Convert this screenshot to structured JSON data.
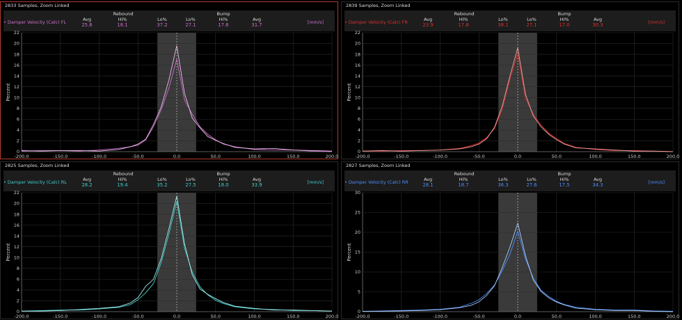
{
  "common": {
    "group_rebound": "Rebound",
    "group_bump": "Bump",
    "stat_labels": [
      "Avg",
      "Hi%",
      "Lo%",
      "Lo%",
      "Hi%",
      "Avg"
    ],
    "unit": "[mm/s]",
    "y_axis_label": "Percent"
  },
  "panels": [
    {
      "title": "2833 Samples, Zoom Linked",
      "legend": "Damper Velocity (Calc) FL",
      "color": "#d070d0",
      "stats": [
        "25.6",
        "18.1",
        "37.2",
        "27.1",
        "17.6",
        "31.7"
      ],
      "active": true
    },
    {
      "title": "2839 Samples, Zoom Linked",
      "legend": "Damper Velocity (Calc) FR",
      "color": "#e03030",
      "stats": [
        "23.9",
        "17.8",
        "38.1",
        "27.1",
        "17.0",
        "30.3"
      ],
      "active": false
    },
    {
      "title": "2825 Samples, Zoom Linked",
      "legend": "Damper Velocity (Calc) RL",
      "color": "#40d0d0",
      "stats": [
        "28.2",
        "19.4",
        "35.2",
        "27.5",
        "18.0",
        "33.9"
      ],
      "active": false
    },
    {
      "title": "2827 Samples, Zoom Linked",
      "legend": "Damper Velocity (Calc) RR",
      "color": "#4a90ff",
      "stats": [
        "28.1",
        "18.7",
        "36.3",
        "27.6",
        "17.5",
        "34.3"
      ],
      "active": false
    }
  ],
  "chart_data": [
    {
      "type": "line",
      "ylabel": "Percent",
      "xlim": [
        -200,
        200
      ],
      "ylim": [
        0,
        22
      ],
      "yticks": [
        0,
        2,
        4,
        6,
        8,
        10,
        12,
        14,
        16,
        18,
        20,
        22
      ],
      "xticks": [
        -200,
        -150,
        -100,
        -50,
        0,
        50,
        100,
        150,
        200
      ],
      "shade_x": [
        -25,
        25
      ],
      "series": [
        {
          "x": [
            -200,
            -175,
            -150,
            -125,
            -100,
            -75,
            -60,
            -50,
            -40,
            -30,
            -20,
            -10,
            0,
            10,
            20,
            30,
            40,
            50,
            60,
            75,
            100,
            125,
            150,
            175,
            200
          ],
          "y": [
            0.1,
            0.2,
            0.2,
            0.1,
            0.3,
            0.6,
            0.9,
            1.2,
            2.2,
            4.6,
            7.8,
            11.8,
            17.1,
            9.6,
            6.9,
            4.6,
            3.2,
            2.2,
            1.4,
            0.9,
            0.4,
            0.3,
            0.3,
            0.1,
            0.0
          ]
        },
        {
          "x": [
            -200,
            -175,
            -150,
            -125,
            -100,
            -75,
            -60,
            -50,
            -40,
            -30,
            -20,
            -10,
            0,
            10,
            20,
            30,
            40,
            50,
            60,
            75,
            100,
            125,
            150,
            175,
            200
          ],
          "y": [
            0.2,
            0.1,
            0.2,
            0.2,
            0.1,
            0.4,
            0.9,
            1.4,
            2.3,
            5.0,
            8.3,
            13.3,
            19.6,
            10.8,
            6.2,
            4.4,
            2.8,
            2.1,
            1.5,
            0.8,
            0.5,
            0.6,
            0.3,
            0.2,
            0.1
          ]
        }
      ]
    },
    {
      "type": "line",
      "ylabel": "Percent",
      "xlim": [
        -200,
        200
      ],
      "ylim": [
        0,
        22
      ],
      "yticks": [
        0,
        2,
        4,
        6,
        8,
        10,
        12,
        14,
        16,
        18,
        20,
        22
      ],
      "xticks": [
        -200,
        -150,
        -100,
        -50,
        0,
        50,
        100,
        150,
        200
      ],
      "shade_x": [
        -25,
        25
      ],
      "series": [
        {
          "x": [
            -200,
            -175,
            -150,
            -125,
            -100,
            -75,
            -60,
            -50,
            -40,
            -30,
            -20,
            -10,
            0,
            10,
            20,
            30,
            40,
            50,
            60,
            75,
            100,
            125,
            150,
            175,
            200
          ],
          "y": [
            0.1,
            0.1,
            0.2,
            0.2,
            0.3,
            0.6,
            1.1,
            1.6,
            2.6,
            4.3,
            7.9,
            13.4,
            18.1,
            9.9,
            6.9,
            4.9,
            3.4,
            2.4,
            1.5,
            0.8,
            0.4,
            0.2,
            0.2,
            0.1,
            0.0
          ]
        },
        {
          "x": [
            -200,
            -175,
            -150,
            -125,
            -100,
            -75,
            -60,
            -50,
            -40,
            -30,
            -20,
            -10,
            0,
            10,
            20,
            30,
            40,
            50,
            60,
            75,
            100,
            125,
            150,
            175,
            200
          ],
          "y": [
            0.1,
            0.2,
            0.1,
            0.2,
            0.3,
            0.5,
            0.9,
            1.4,
            2.4,
            4.5,
            8.4,
            14.0,
            19.2,
            10.6,
            6.6,
            4.6,
            3.2,
            2.2,
            1.4,
            0.7,
            0.5,
            0.3,
            0.1,
            0.1,
            0.0
          ]
        }
      ]
    },
    {
      "type": "line",
      "ylabel": "Percent",
      "xlim": [
        -200,
        200
      ],
      "ylim": [
        0,
        22
      ],
      "yticks": [
        0,
        2,
        4,
        6,
        8,
        10,
        12,
        14,
        16,
        18,
        20,
        22
      ],
      "xticks": [
        -200,
        -150,
        -100,
        -50,
        0,
        50,
        100,
        150,
        200
      ],
      "shade_x": [
        -25,
        25
      ],
      "series": [
        {
          "x": [
            -200,
            -175,
            -150,
            -125,
            -100,
            -75,
            -60,
            -50,
            -40,
            -30,
            -20,
            -10,
            0,
            10,
            20,
            30,
            40,
            50,
            60,
            75,
            100,
            125,
            150,
            175,
            200
          ],
          "y": [
            0.1,
            0.2,
            0.3,
            0.3,
            0.5,
            0.8,
            1.3,
            2.2,
            3.5,
            5.2,
            9.1,
            14.4,
            20.4,
            11.8,
            7.3,
            4.6,
            3.1,
            2.1,
            1.5,
            0.9,
            0.5,
            0.4,
            0.2,
            0.2,
            0.1
          ]
        },
        {
          "x": [
            -200,
            -175,
            -150,
            -125,
            -100,
            -75,
            -60,
            -50,
            -40,
            -30,
            -20,
            -10,
            0,
            10,
            20,
            30,
            40,
            50,
            60,
            75,
            100,
            125,
            150,
            175,
            200
          ],
          "y": [
            0.1,
            0.1,
            0.2,
            0.4,
            0.6,
            0.9,
            1.6,
            2.6,
            4.7,
            6.0,
            9.8,
            15.4,
            21.4,
            12.6,
            6.8,
            4.2,
            3.2,
            2.4,
            1.7,
            1.0,
            0.6,
            0.3,
            0.3,
            0.2,
            0.1
          ]
        }
      ]
    },
    {
      "type": "line",
      "ylabel": "Percent",
      "xlim": [
        -200,
        200
      ],
      "ylim": [
        0,
        30
      ],
      "yticks": [
        0,
        5,
        10,
        15,
        20,
        25,
        30
      ],
      "xticks": [
        -200,
        -150,
        -100,
        -50,
        0,
        50,
        100,
        150,
        200
      ],
      "shade_x": [
        -25,
        25
      ],
      "series": [
        {
          "x": [
            -200,
            -175,
            -150,
            -125,
            -100,
            -75,
            -60,
            -50,
            -40,
            -30,
            -20,
            -10,
            0,
            10,
            20,
            30,
            40,
            50,
            60,
            75,
            100,
            125,
            150,
            175,
            200
          ],
          "y": [
            0.1,
            0.2,
            0.3,
            0.4,
            0.6,
            1.1,
            2.1,
            3.0,
            4.6,
            6.7,
            10.3,
            14.5,
            20.3,
            13.3,
            8.5,
            5.4,
            3.8,
            2.6,
            1.8,
            1.1,
            0.6,
            0.4,
            0.4,
            0.2,
            0.1
          ]
        },
        {
          "x": [
            -200,
            -175,
            -150,
            -125,
            -100,
            -75,
            -60,
            -50,
            -40,
            -30,
            -20,
            -10,
            0,
            10,
            20,
            30,
            40,
            50,
            60,
            75,
            100,
            125,
            150,
            175,
            200
          ],
          "y": [
            0.1,
            0.1,
            0.2,
            0.3,
            0.5,
            1.0,
            1.6,
            2.5,
            4.1,
            6.5,
            11.1,
            16.3,
            22.3,
            14.1,
            8.0,
            5.1,
            3.5,
            2.4,
            1.7,
            0.9,
            0.5,
            0.3,
            0.3,
            0.1,
            0.0
          ]
        }
      ]
    }
  ]
}
